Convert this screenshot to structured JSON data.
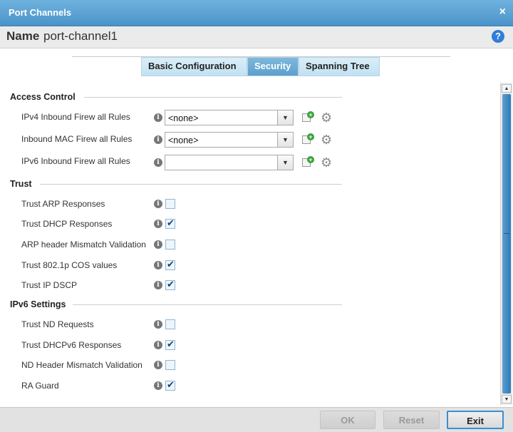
{
  "window": {
    "title": "Port Channels",
    "close": "×"
  },
  "name_bar": {
    "label": "Name",
    "value": "port-channel1",
    "help": "?"
  },
  "tabs": [
    {
      "label": "Basic Configuration",
      "active": false
    },
    {
      "label": "Security",
      "active": true
    },
    {
      "label": "Spanning Tree",
      "active": false
    }
  ],
  "access_control": {
    "heading": "Access Control",
    "rows": [
      {
        "label": "IPv4 Inbound Firew all Rules",
        "value": "<none>"
      },
      {
        "label": "Inbound MAC Firew all Rules",
        "value": "<none>"
      },
      {
        "label": "IPv6 Inbound Firew all Rules",
        "value": ""
      }
    ]
  },
  "trust": {
    "heading": "Trust",
    "rows": [
      {
        "label": "Trust ARP Responses",
        "checked": false
      },
      {
        "label": "Trust DHCP Responses",
        "checked": true
      },
      {
        "label": "ARP header Mismatch Validation",
        "checked": false
      },
      {
        "label": "Trust 802.1p COS values",
        "checked": true
      },
      {
        "label": "Trust IP DSCP",
        "checked": true
      }
    ]
  },
  "ipv6_settings": {
    "heading": "IPv6 Settings",
    "rows": [
      {
        "label": "Trust ND Requests",
        "checked": false
      },
      {
        "label": "Trust DHCPv6 Responses",
        "checked": true
      },
      {
        "label": "ND Header Mismatch Validation",
        "checked": false
      },
      {
        "label": "RA Guard",
        "checked": true
      }
    ]
  },
  "footer": {
    "ok": "OK",
    "reset": "Reset",
    "exit": "Exit"
  },
  "icons": {
    "info": "info-icon",
    "add": "add-rule-icon",
    "gear": "gear-icon",
    "dropdown": "chevron-down-icon"
  },
  "colors": {
    "title_bar": "#4a93c9",
    "active_tab": "#5c9fcc",
    "primary_border": "#3b8fd1"
  }
}
